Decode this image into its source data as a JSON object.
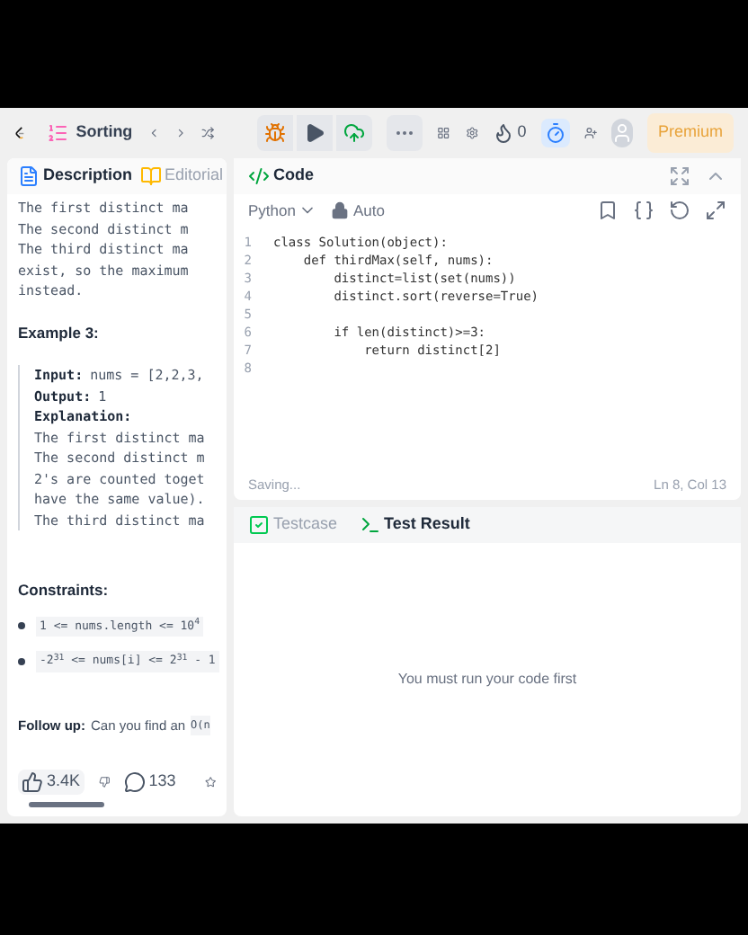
{
  "top_bar": {
    "problem_list": "Sorting",
    "streak": "0",
    "premium": "Premium"
  },
  "description_tabs": [
    {
      "label": "Description",
      "selected": true
    },
    {
      "label": "Editorial",
      "selected": false
    }
  ],
  "description": {
    "block1": [
      "The first distinct ma",
      "The second distinct m",
      "The third distinct ma",
      "exist, so the maximum",
      "instead."
    ],
    "example_title": "Example 3:",
    "example": [
      {
        "kind": "field",
        "label": "Input:",
        "value": "nums = [2,2,3,"
      },
      {
        "kind": "field",
        "label": "Output:",
        "value": "1"
      },
      {
        "kind": "heading",
        "label": "Explanation:"
      },
      {
        "kind": "text",
        "value": "The first distinct ma"
      },
      {
        "kind": "text",
        "value": "The second distinct m"
      },
      {
        "kind": "text",
        "value": "2's are counted toget"
      },
      {
        "kind": "text",
        "value": "have the same value)."
      },
      {
        "kind": "text",
        "value": "The third distinct ma"
      }
    ],
    "constraints_title": "Constraints:",
    "constraints": [
      "1 <= nums.length <= 10$^{4}$",
      "-2$^{31}$ <= nums[i] <= 2$^{31}$ - 1"
    ],
    "follow_up_label": "Follow up:",
    "follow_up_text": "Can you find an",
    "follow_up_code": "O(n"
  },
  "stats": {
    "likes": "3.4K",
    "comments": "133"
  },
  "code_panel": {
    "title": "Code",
    "language": "Python",
    "mode": "Auto",
    "lines": [
      {
        "number": "1",
        "text": "class Solution(object):"
      },
      {
        "number": "2",
        "text": "    def thirdMax(self, nums):"
      },
      {
        "number": "3",
        "text": "        distinct=list(set(nums))"
      },
      {
        "number": "4",
        "text": "        distinct.sort(reverse=True)"
      },
      {
        "number": "5"
      },
      {
        "number": "6",
        "text": "        if len(distinct)>=3:"
      },
      {
        "number": "7",
        "text": "            return distinct[2]"
      },
      {
        "number": "8"
      }
    ],
    "status": "Saving...",
    "position": "Ln 8, Col 13"
  },
  "result_tabs": [
    {
      "label": "Testcase",
      "selected": false
    },
    {
      "label": "Test Result",
      "selected": true
    }
  ],
  "result_message": "You must run your code first"
}
